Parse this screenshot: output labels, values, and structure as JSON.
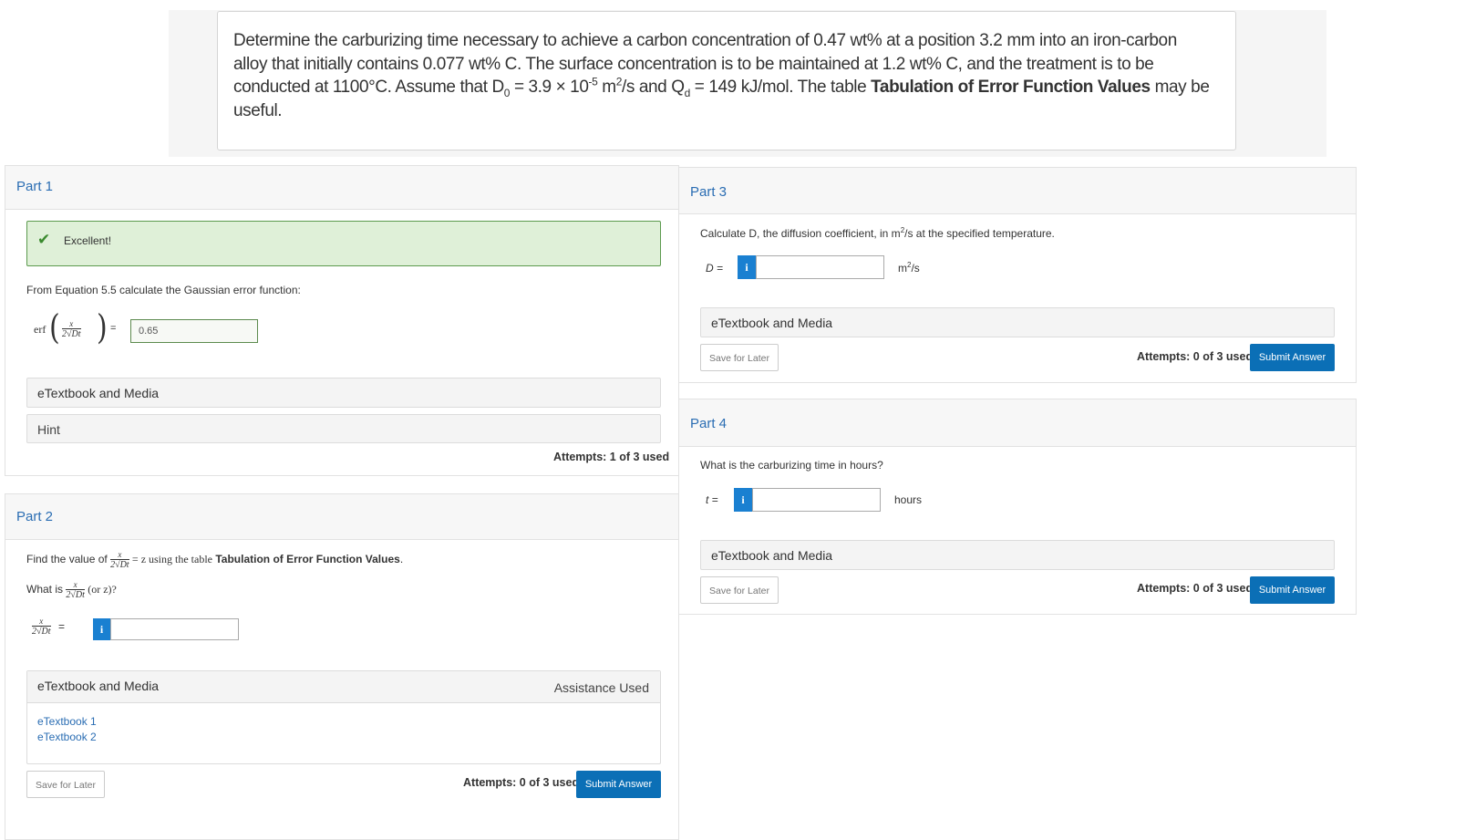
{
  "problem": {
    "line1": "Determine the carburizing time necessary to achieve a carbon concentration of 0.47 wt% at a position 3.2 mm into an iron-carbon",
    "line2": "alloy that initially contains 0.077 wt% C. The surface concentration is to be maintained at 1.2 wt% C, and the treatment is to be",
    "line3_pre": "conducted at 1100°C. Assume that D",
    "d_sub": "0",
    "line3_mid1": " = 3.9 × 10",
    "exp": "-5",
    "line3_mid2": " m",
    "sq": "2",
    "line3_mid3": "/s and Q",
    "q_sub": "d",
    "line3_mid4": " = 149 kJ/mol. The table ",
    "table_link": "Tabulation of Error Function Values",
    "line3_post": " may be",
    "line4": "useful."
  },
  "part1": {
    "title": "Part 1",
    "feedback": "Excellent!",
    "prompt": "From Equation 5.5 calculate the Gaussian error function:",
    "erf_label": "erf",
    "frac_num": "x",
    "frac_den": "2√Dt",
    "equals": "=",
    "answer": "0.65",
    "etextbook": "eTextbook and Media",
    "hint": "Hint",
    "attempts": "Attempts: 1 of 3 used"
  },
  "part2": {
    "title": "Part 2",
    "prompt_pre": "Find the value of",
    "prompt_mid": "= z using the table",
    "prompt_bold": "Tabulation of Error Function Values",
    "prompt_end": ".",
    "question_pre": "What is",
    "question_post": "(or z)?",
    "frac_num": "x",
    "frac_den": "2√Dt",
    "equals": "=",
    "answer": "",
    "etextbook": "eTextbook and Media",
    "assistance": "Assistance Used",
    "links": [
      "eTextbook 1",
      "eTextbook 2"
    ],
    "save": "Save for Later",
    "attempts": "Attempts: 0 of 3 used",
    "submit": "Submit Answer"
  },
  "part3": {
    "title": "Part 3",
    "prompt_pre": "Calculate D, the diffusion coefficient, in m",
    "sq": "2",
    "prompt_post": "/s at the specified temperature.",
    "var": "D =",
    "answer": "",
    "unit": "m",
    "unit_sq": "2",
    "unit_post": "/s",
    "etextbook": "eTextbook and Media",
    "save": "Save for Later",
    "attempts": "Attempts: 0 of 3 used",
    "submit": "Submit Answer"
  },
  "part4": {
    "title": "Part 4",
    "prompt": "What is the carburizing time in hours?",
    "var": "t =",
    "answer": "",
    "unit": "hours",
    "etextbook": "eTextbook and Media",
    "save": "Save for Later",
    "attempts": "Attempts: 0 of 3 used",
    "submit": "Submit Answer"
  },
  "icons": {
    "info": "i",
    "check": "✔"
  },
  "colors": {
    "accent": "#2a6db3",
    "button": "#0b6fb6",
    "success_bg": "#dff0d8",
    "success_border": "#5c9a4e"
  }
}
